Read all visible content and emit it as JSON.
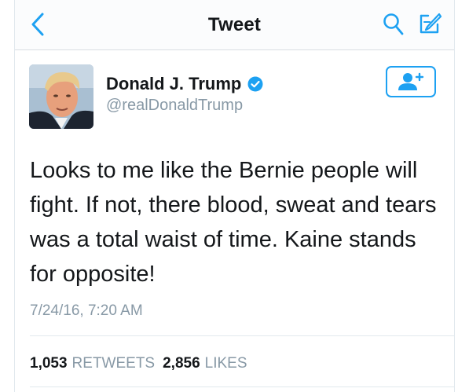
{
  "colors": {
    "accent": "#1da1f2",
    "text": "#14171a",
    "muted": "#8899a6",
    "border": "#e1e8ed"
  },
  "navbar": {
    "title": "Tweet",
    "back_icon": "chevron-left-icon",
    "search_icon": "search-icon",
    "compose_icon": "compose-icon"
  },
  "tweet": {
    "author": {
      "name": "Donald J. Trump",
      "handle": "@realDonaldTrump",
      "verified_icon": "verified-badge-icon",
      "follow_icon": "add-user-icon"
    },
    "text": "Looks to me like the Bernie people will fight. If not, there blood, sweat and tears was a total waist of time. Kaine stands for opposite!",
    "timestamp": "7/24/16, 7:20 AM",
    "stats": {
      "retweets_count": "1,053",
      "retweets_label": "RETWEETS",
      "likes_count": "2,856",
      "likes_label": "LIKES"
    }
  }
}
